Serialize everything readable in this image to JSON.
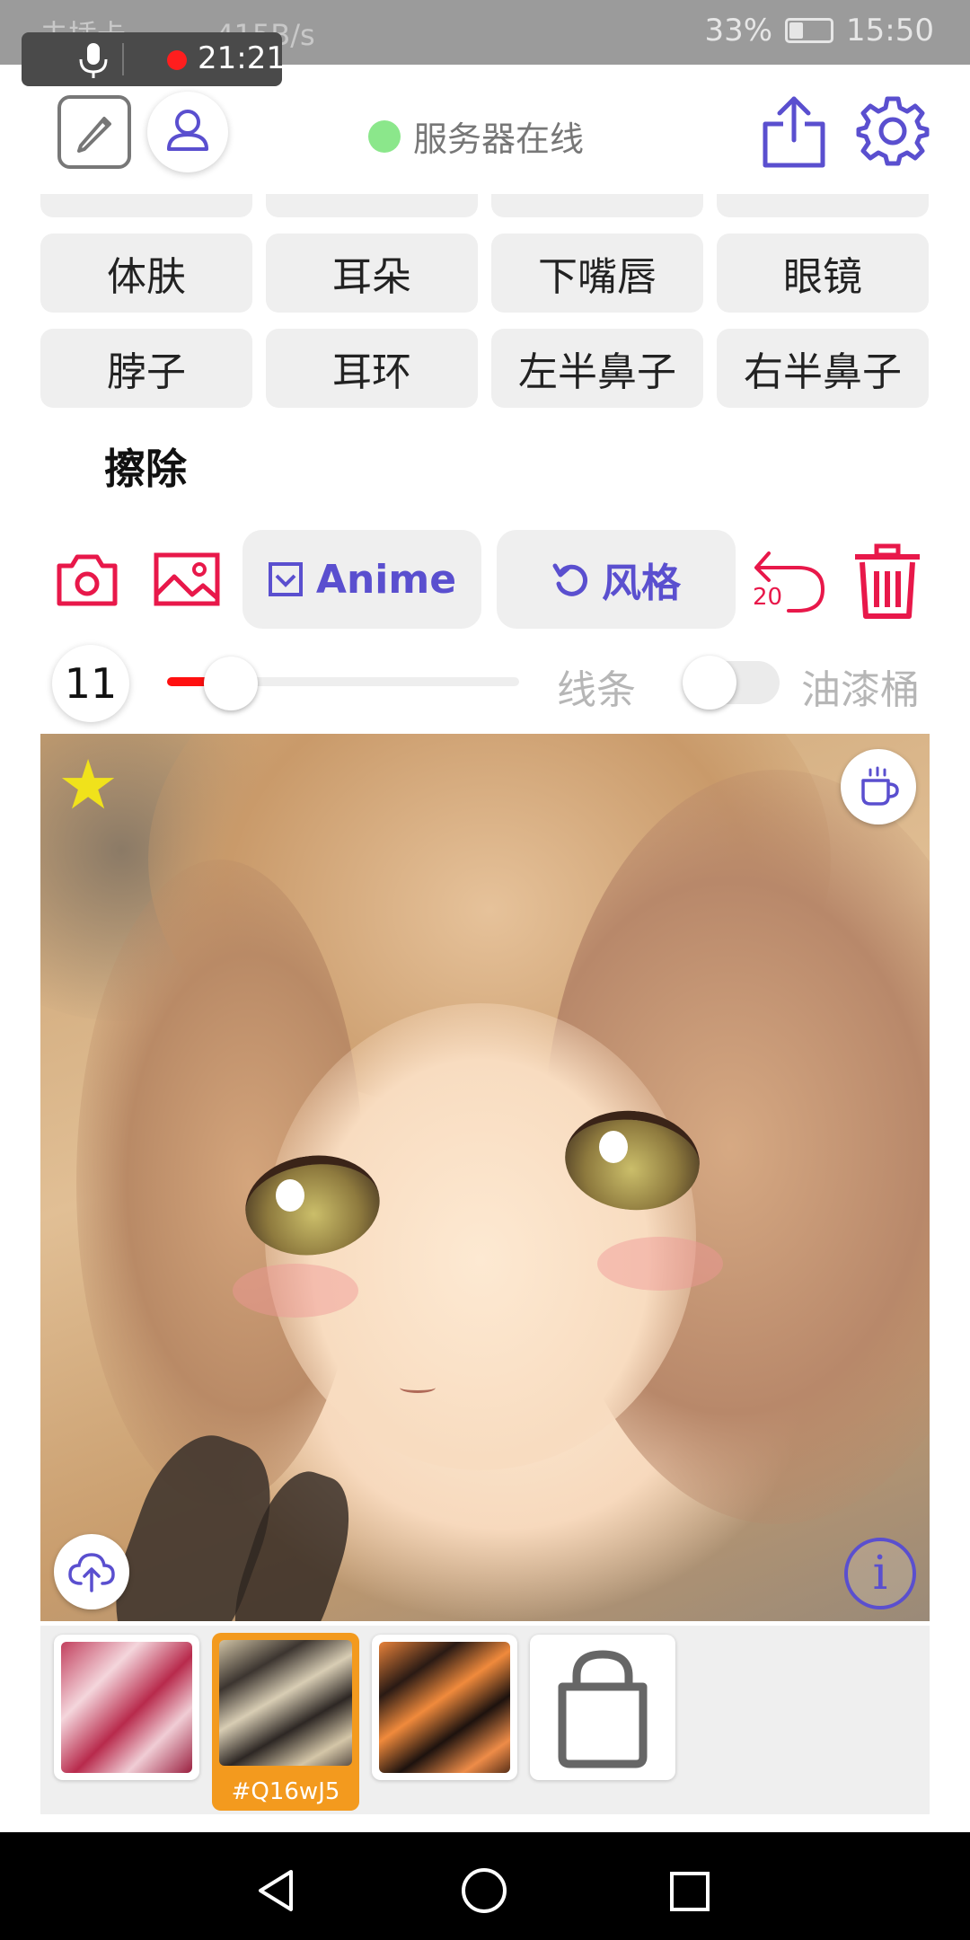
{
  "status_bar": {
    "carrier": "未插卡",
    "speed": "415B/s",
    "battery": "33%",
    "battery_level": 0.33,
    "clock": "15:50"
  },
  "recording": {
    "time": "21:21"
  },
  "header": {
    "server_status": "服务器在线"
  },
  "parts": {
    "row1": [
      "体肤",
      "耳朵",
      "下嘴唇",
      "眼镜"
    ],
    "row2": [
      "脖子",
      "耳环",
      "左半鼻子",
      "右半鼻子"
    ],
    "erase": "擦除"
  },
  "toolbar": {
    "anime_label": "Anime",
    "style_label": "风格",
    "undo_count": "20"
  },
  "brush": {
    "size": "11",
    "slider_fraction": 0.18,
    "lines_label": "线条",
    "bucket_label": "油漆桶",
    "bucket_on": false
  },
  "canvas": {
    "info_glyph": "i"
  },
  "thumbnails": {
    "selected_label": "#Q16wJ5"
  },
  "colors": {
    "accent": "#5a4fcf",
    "danger": "#e8184a",
    "selected": "#f39a1e",
    "online": "#8be78b"
  },
  "icons": [
    "edit-icon",
    "user-icon",
    "share-icon",
    "gear-icon",
    "camera-icon",
    "gallery-icon",
    "checkbox-icon",
    "refresh-icon",
    "undo-icon",
    "trash-icon",
    "star-icon",
    "coffee-icon",
    "cloud-upload-icon",
    "info-icon",
    "bag-icon",
    "back-icon",
    "home-icon",
    "recent-icon"
  ]
}
